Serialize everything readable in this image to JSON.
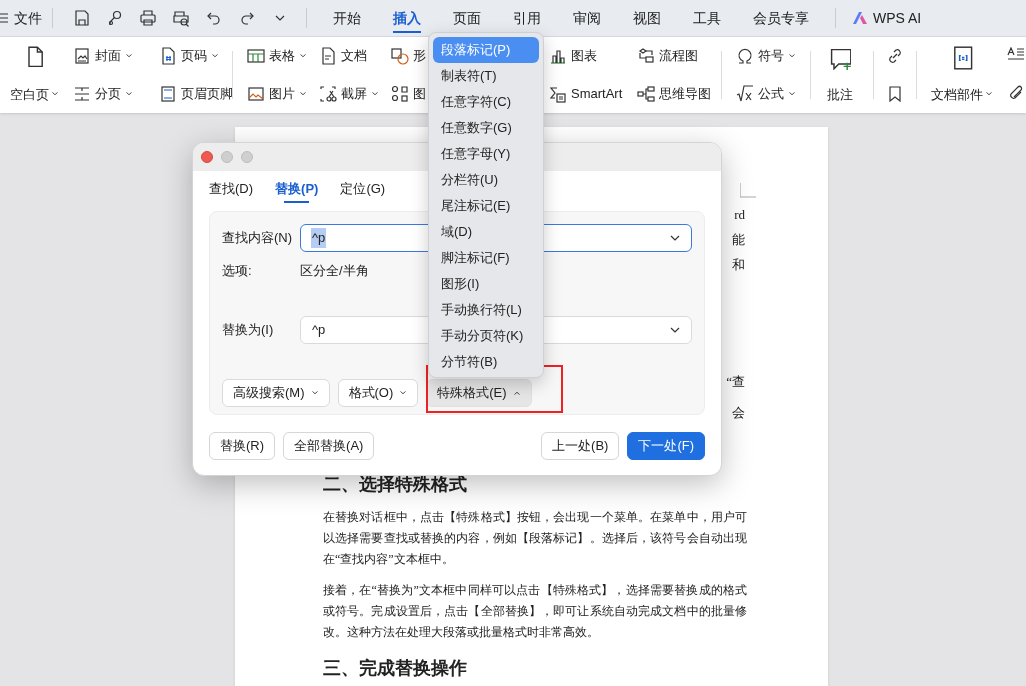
{
  "menu": {
    "label": "文件"
  },
  "tabs": [
    {
      "label": "开始",
      "selected": false
    },
    {
      "label": "插入",
      "selected": true
    },
    {
      "label": "页面",
      "selected": false
    },
    {
      "label": "引用",
      "selected": false
    },
    {
      "label": "审阅",
      "selected": false
    },
    {
      "label": "视图",
      "selected": false
    },
    {
      "label": "工具",
      "selected": false
    },
    {
      "label": "会员专享",
      "selected": false
    }
  ],
  "ai_button": {
    "label": "WPS AI"
  },
  "ribbon": [
    [
      {
        "kind": "large",
        "label": "空白页",
        "dropdown": true
      },
      {
        "kind": "stack",
        "items": [
          {
            "label": "封面",
            "dropdown": true
          },
          {
            "label": "分页",
            "dropdown": true
          }
        ]
      },
      {
        "kind": "stack",
        "items": [
          {
            "label": "页码",
            "dropdown": true
          },
          {
            "label": "页眉页脚",
            "dropdown": false
          }
        ]
      }
    ],
    [
      {
        "kind": "stack",
        "items": [
          {
            "label": "表格",
            "dropdown": true
          },
          {
            "label": "图片",
            "dropdown": true
          }
        ]
      },
      {
        "kind": "stack",
        "items": [
          {
            "label": "文档",
            "dropdown": false
          },
          {
            "label": "截屏",
            "dropdown": true
          }
        ]
      },
      {
        "kind": "stack",
        "items": [
          {
            "label": "形",
            "dropdown": false
          },
          {
            "label": "图",
            "dropdown": false
          }
        ]
      },
      {
        "kind": "stack",
        "items": [
          {
            "label": "图表",
            "dropdown": false
          },
          {
            "label": "SmartArt",
            "dropdown": false
          }
        ]
      },
      {
        "kind": "stack",
        "items": [
          {
            "label": "流程图",
            "dropdown": false
          },
          {
            "label": "思维导图",
            "dropdown": false
          }
        ]
      }
    ],
    [
      {
        "kind": "stack",
        "items": [
          {
            "label": "符号",
            "dropdown": true
          },
          {
            "label": "公式",
            "dropdown": true
          }
        ]
      }
    ],
    [
      {
        "kind": "large",
        "label": "批注",
        "dropdown": false
      }
    ],
    [
      {
        "kind": "stack",
        "items": [
          {
            "dropdown": false
          },
          {
            "dropdown": false
          }
        ]
      }
    ],
    [
      {
        "kind": "large",
        "label": "文档部件",
        "dropdown": true
      },
      {
        "kind": "stack",
        "items": [
          {
            "dropdown": false
          },
          {
            "dropdown": false
          }
        ]
      }
    ]
  ],
  "document": {
    "line_ends": [
      "rd",
      "能",
      "和",
      "“查",
      "会"
    ],
    "headings": [
      "二、选择特殊格式",
      "三、完成替换操作"
    ],
    "paragraphs": [
      "在替换对话框中，点击【特殊格式】按钮，会出现一个菜单。在菜单中，用户可以选择需要查找或替换的内容，例如【段落标记】。选择后，该符号会自动出现在“查找内容”文本框中。",
      "接着，在“替换为”文本框中同样可以点击【特殊格式】，选择需要替换成的格式或符号。完成设置后，点击【全部替换】，即可让系统自动完成文档中的批量修改。这种方法在处理大段落或批量格式时非常高效。"
    ]
  },
  "dialog": {
    "tabs": [
      {
        "label": "查找(D)",
        "selected": false
      },
      {
        "label": "替换(P)",
        "selected": true
      },
      {
        "label": "定位(G)",
        "selected": false
      }
    ],
    "find": {
      "label": "查找内容(N)",
      "value": "^p"
    },
    "options": {
      "label": "选项:",
      "value": "区分全/半角"
    },
    "replace": {
      "label": "替换为(I)",
      "value": "^p"
    },
    "option_buttons": [
      {
        "label": "高级搜索(M)",
        "expanded": false
      },
      {
        "label": "格式(O)",
        "expanded": false
      },
      {
        "label": "特殊格式(E)",
        "expanded": true
      }
    ],
    "actions": [
      {
        "label": "替换(R)",
        "primary": false
      },
      {
        "label": "全部替换(A)",
        "primary": false
      },
      {
        "label": "上一处(B)",
        "primary": false
      },
      {
        "label": "下一处(F)",
        "primary": true
      }
    ]
  },
  "special_menu": [
    {
      "label": "段落标记(P)",
      "selected": true
    },
    {
      "label": "制表符(T)",
      "selected": false
    },
    {
      "label": "任意字符(C)",
      "selected": false
    },
    {
      "label": "任意数字(G)",
      "selected": false
    },
    {
      "label": "任意字母(Y)",
      "selected": false
    },
    {
      "label": "分栏符(U)",
      "selected": false
    },
    {
      "label": "尾注标记(E)",
      "selected": false
    },
    {
      "label": "域(D)",
      "selected": false
    },
    {
      "label": "脚注标记(F)",
      "selected": false
    },
    {
      "label": "图形(I)",
      "selected": false
    },
    {
      "label": "手动换行符(L)",
      "selected": false
    },
    {
      "label": "手动分页符(K)",
      "selected": false
    },
    {
      "label": "分节符(B)",
      "selected": false
    }
  ]
}
